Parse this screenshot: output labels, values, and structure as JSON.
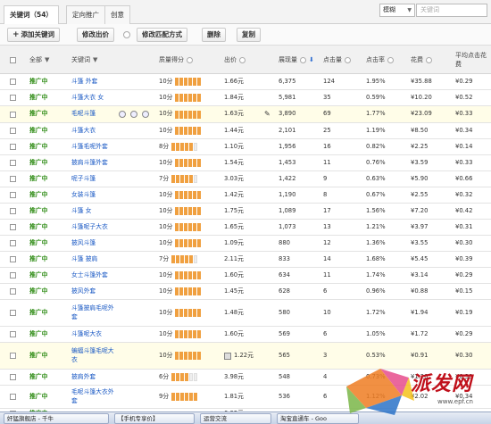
{
  "tabs": [
    "关键词（54）",
    "定向推广",
    "创意"
  ],
  "filter": {
    "selected": "模糊",
    "placeholder": "关键词"
  },
  "toolbar": {
    "add_keyword": "添加关键词",
    "modify_bid": "修改出价",
    "modify_match": "修改匹配方式",
    "delete": "删除",
    "copy": "复制"
  },
  "columns": {
    "all": "全部",
    "keyword": "关键词",
    "quality": "质量得分",
    "bid": "出价",
    "impressions": "展现量",
    "clicks": "点击量",
    "ctr": "点击率",
    "cost": "花费",
    "avg_cpc": "平均点击花费"
  },
  "rows": [
    {
      "status": "推广中",
      "keyword": "斗篷 外套",
      "quality": "10分",
      "bid": "1.66元",
      "impressions": "6,375",
      "clicks": "124",
      "ctr": "1.95%",
      "cost": "¥35.88",
      "cpc": "¥0.29"
    },
    {
      "status": "推广中",
      "keyword": "斗篷大衣 女",
      "quality": "10分",
      "bid": "1.84元",
      "impressions": "5,981",
      "clicks": "35",
      "ctr": "0.59%",
      "cost": "¥10.20",
      "cpc": "¥0.52"
    },
    {
      "status": "推广中",
      "keyword": "毛呢斗篷",
      "quality": "10分",
      "bid": "1.63元",
      "impressions": "3,890",
      "clicks": "69",
      "ctr": "1.77%",
      "cost": "¥23.09",
      "cpc": "¥0.33"
    },
    {
      "status": "推广中",
      "keyword": "斗篷大衣",
      "quality": "10分",
      "bid": "1.44元",
      "impressions": "2,101",
      "clicks": "25",
      "ctr": "1.19%",
      "cost": "¥8.50",
      "cpc": "¥0.34"
    },
    {
      "status": "推广中",
      "keyword": "斗篷毛呢外套",
      "quality": "8分",
      "bid": "1.10元",
      "impressions": "1,956",
      "clicks": "16",
      "ctr": "0.82%",
      "cost": "¥2.25",
      "cpc": "¥0.14"
    },
    {
      "status": "推广中",
      "keyword": "披肩斗篷外套",
      "quality": "10分",
      "bid": "1.54元",
      "impressions": "1,453",
      "clicks": "11",
      "ctr": "0.76%",
      "cost": "¥3.59",
      "cpc": "¥0.33"
    },
    {
      "status": "推广中",
      "keyword": "呢子斗篷",
      "quality": "7分",
      "bid": "3.03元",
      "impressions": "1,422",
      "clicks": "9",
      "ctr": "0.63%",
      "cost": "¥5.90",
      "cpc": "¥0.66"
    },
    {
      "status": "推广中",
      "keyword": "女装斗篷",
      "quality": "10分",
      "bid": "1.42元",
      "impressions": "1,190",
      "clicks": "8",
      "ctr": "0.67%",
      "cost": "¥2.55",
      "cpc": "¥0.32"
    },
    {
      "status": "推广中",
      "keyword": "斗篷 女",
      "quality": "10分",
      "bid": "1.75元",
      "impressions": "1,089",
      "clicks": "17",
      "ctr": "1.56%",
      "cost": "¥7.20",
      "cpc": "¥0.42"
    },
    {
      "status": "推广中",
      "keyword": "斗篷呢子大衣",
      "quality": "10分",
      "bid": "1.65元",
      "impressions": "1,073",
      "clicks": "13",
      "ctr": "1.21%",
      "cost": "¥3.97",
      "cpc": "¥0.31"
    },
    {
      "status": "推广中",
      "keyword": "披风斗篷",
      "quality": "10分",
      "bid": "1.09元",
      "impressions": "880",
      "clicks": "12",
      "ctr": "1.36%",
      "cost": "¥3.55",
      "cpc": "¥0.30"
    },
    {
      "status": "推广中",
      "keyword": "斗篷 披肩",
      "quality": "7分",
      "bid": "2.11元",
      "impressions": "833",
      "clicks": "14",
      "ctr": "1.68%",
      "cost": "¥5.45",
      "cpc": "¥0.39"
    },
    {
      "status": "推广中",
      "keyword": "女士斗篷外套",
      "quality": "10分",
      "bid": "1.60元",
      "impressions": "634",
      "clicks": "11",
      "ctr": "1.74%",
      "cost": "¥3.14",
      "cpc": "¥0.29"
    },
    {
      "status": "推广中",
      "keyword": "披风外套",
      "quality": "10分",
      "bid": "1.45元",
      "impressions": "628",
      "clicks": "6",
      "ctr": "0.96%",
      "cost": "¥0.88",
      "cpc": "¥0.15"
    },
    {
      "status": "推广中",
      "keyword": "斗篷披肩毛呢外套",
      "quality": "10分",
      "bid": "1.48元",
      "impressions": "580",
      "clicks": "10",
      "ctr": "1.72%",
      "cost": "¥1.94",
      "cpc": "¥0.19"
    },
    {
      "status": "推广中",
      "keyword": "斗篷呢大衣",
      "quality": "10分",
      "bid": "1.60元",
      "impressions": "569",
      "clicks": "6",
      "ctr": "1.05%",
      "cost": "¥1.72",
      "cpc": "¥0.29"
    },
    {
      "status": "推广中",
      "keyword": "蝙蝠斗篷毛呢大衣",
      "quality": "10分",
      "bid": "1.22元",
      "impressions": "565",
      "clicks": "3",
      "ctr": "0.53%",
      "cost": "¥0.91",
      "cpc": "¥0.30"
    },
    {
      "status": "推广中",
      "keyword": "披肩外套",
      "quality": "6分",
      "bid": "3.98元",
      "impressions": "548",
      "clicks": "4",
      "ctr": "0.73%",
      "cost": "¥1.20",
      "cpc": "¥0.30"
    },
    {
      "status": "推广中",
      "keyword": "毛呢斗篷大衣外套",
      "quality": "9分",
      "bid": "1.81元",
      "impressions": "536",
      "clicks": "6",
      "ctr": "1.12%",
      "cost": "¥2.02",
      "cpc": "¥0.34"
    },
    {
      "status": "推广中",
      "keyword": "",
      "quality": "",
      "bid": "0.39元",
      "impressions": "",
      "clicks": "",
      "ctr": "",
      "cost": "",
      "cpc": ""
    }
  ],
  "taskbar": [
    "奸猛旗舰店 - 千牛",
    "【手机专享价】",
    "运营交流",
    "淘宝直通车 - Goo"
  ],
  "watermark": {
    "text": "派发网",
    "url": "www.epf.cn"
  },
  "colors": {
    "status": "#2e8b14",
    "keyword": "#1a59c4",
    "quality_bar": "#f0a040",
    "highlight_row": "#fffde8"
  }
}
